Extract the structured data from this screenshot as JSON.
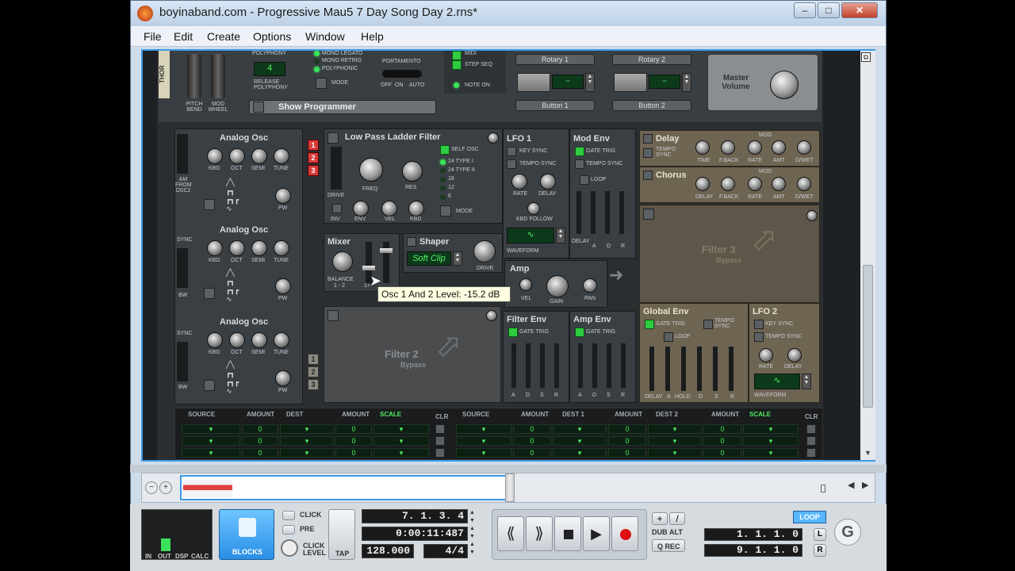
{
  "window": {
    "title": "boyinaband.com - Progressive Mau5 7 Day Song Day 2.rns*"
  },
  "menu": [
    "File",
    "Edit",
    "Create",
    "Options",
    "Window",
    "Help"
  ],
  "top_panel": {
    "pitch_bend": "PITCH BEND",
    "mod_wheel": "MOD WHEEL",
    "polyphony": "POLYPHONY",
    "polyphony_value": "4",
    "release_polyphony": "RELEASE POLYPHONY",
    "mono_legato": "MONO LEGATO",
    "mono_retrig": "MONO RETRIG",
    "poly_mode": "POLYPHONIC",
    "mode": "MODE",
    "portamento": "PORTAMENTO",
    "porta_off": "OFF",
    "porta_on": "ON",
    "porta_auto": "AUTO",
    "midi": "MIDI",
    "step_seq": "STEP SEQ",
    "note_on": "NOTE ON",
    "rotary1": "Rotary 1",
    "rotary2": "Rotary 2",
    "button1": "Button 1",
    "button2": "Button 2",
    "master_volume": "Master Volume",
    "show_programmer": "Show Programmer",
    "thor_label": "THOR"
  },
  "osc": {
    "title": "Analog Osc",
    "kbd": "KBD",
    "oct": "OCT",
    "semi": "SEMI",
    "tune": "TUNE",
    "pw": "PW",
    "am_from_osc2": "AM FROM OSC2",
    "sync": "SYNC",
    "bw": "BW",
    "slot1": "1",
    "slot2": "2",
    "slot3": "3"
  },
  "filter1": {
    "title": "Low Pass Ladder Filter",
    "self_osc": "SELF OSC",
    "type1": "24 TYPE I",
    "type2": "24 TYPE II",
    "t18": "18",
    "t12": "12",
    "t6": "6",
    "freq": "FREQ",
    "res": "RES",
    "drive": "DRIVE",
    "inv": "INV",
    "env": "ENV",
    "vel": "VEL",
    "kbd": "KBD",
    "mode": "MODE"
  },
  "mixer": {
    "title": "Mixer",
    "balance": "BALANCE",
    "balance_sub": "1 - 2",
    "level_sub": "1+"
  },
  "shaper": {
    "title": "Shaper",
    "mode": "Soft Clip",
    "drive": "DRIVE"
  },
  "amp": {
    "title": "Amp",
    "vel": "VEL",
    "gain": "GAIN",
    "pan": "PAN"
  },
  "filter2": {
    "title": "Filter 2",
    "bypass": "Bypass"
  },
  "filter3": {
    "title": "Filter 3",
    "bypass": "Bypass"
  },
  "lfo1": {
    "title": "LFO 1",
    "key_sync": "KEY SYNC",
    "tempo_sync": "TEMPO SYNC",
    "rate": "RATE",
    "delay": "DELAY",
    "kbd_follow": "KBD FOLLOW",
    "waveform": "WAVEFORM"
  },
  "mod_env": {
    "title": "Mod Env",
    "gate_trig": "GATE TRIG",
    "tempo_sync": "TEMPO SYNC",
    "loop": "LOOP",
    "delay": "DELAY",
    "a": "A",
    "d": "D",
    "r": "R"
  },
  "filter_env": {
    "title": "Filter Env",
    "gate_trig": "GATE TRIG",
    "a": "A",
    "d": "D",
    "s": "S",
    "r": "R"
  },
  "amp_env": {
    "title": "Amp Env",
    "gate_trig": "GATE TRIG",
    "a": "A",
    "d": "D",
    "s": "S",
    "r": "R"
  },
  "delay": {
    "title": "Delay",
    "tempo_sync": "TEMPO SYNC",
    "time": "TIME",
    "fback": "F.BACK",
    "mod": "MOD",
    "rate": "RATE",
    "amt": "AMT",
    "dwet": "D/WET"
  },
  "chorus": {
    "title": "Chorus",
    "delay": "DELAY",
    "fback": "F.BACK",
    "mod": "MOD",
    "rate": "RATE",
    "amt": "AMT",
    "dwet": "D/WET"
  },
  "global_env": {
    "title": "Global Env",
    "gate_trig": "GATE TRIG",
    "tempo_sync": "TEMPO SYNC",
    "loop": "LOOP",
    "delay": "DELAY",
    "a": "A",
    "hold": "HOLD",
    "d": "D",
    "s": "S",
    "r": "R"
  },
  "lfo2": {
    "title": "LFO 2",
    "key_sync": "KEY SYNC",
    "tempo_sync": "TEMPO SYNC",
    "rate": "RATE",
    "delay": "DELAY",
    "waveform": "WAVEFORM"
  },
  "matrix": {
    "source": "SOURCE",
    "amount": "AMOUNT",
    "dest": "DEST",
    "scale": "SCALE",
    "clr": "CLR",
    "dest1": "DEST 1",
    "dest2": "DEST 2",
    "zero": "0"
  },
  "tooltip": "Osc 1 And 2 Level: -15.2 dB",
  "transport": {
    "in": "IN",
    "out": "OUT",
    "dsp": "DSP",
    "calc": "CALC",
    "blocks": "BLOCKS",
    "click": "CLICK",
    "pre": "PRE",
    "click_level": "CLICK LEVEL",
    "tap": "TAP",
    "position": "7. 1. 3.   4",
    "time": "0:00:11:487",
    "tempo": "128.000",
    "signature": "4/4",
    "dub": "DUB",
    "alt": "ALT",
    "q_rec": "Q REC",
    "loop": "LOOP",
    "left_loc": "1. 1. 1.    0",
    "right_loc": "9. 1. 1.    0",
    "l": "L",
    "r": "R"
  }
}
